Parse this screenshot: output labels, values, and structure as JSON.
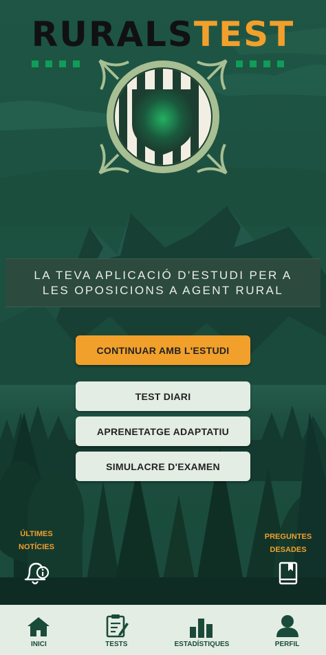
{
  "header": {
    "title_part1": "RURALS",
    "title_part2": "TEST"
  },
  "tagline": "LA TEVA APLICACIÓ D'ESTUDI PER A LES OPOSICIONS A AGENT RURAL",
  "actions": {
    "continue_label": "CONTINUAR AMB L'ESTUDI",
    "daily_test_label": "TEST DIARI",
    "adaptive_learning_label": "APRENETATGE ADAPTATIU",
    "exam_simulation_label": "SIMULACRE D'EXAMEN"
  },
  "shortcuts": {
    "news_line1": "ÚLTIMES",
    "news_line2": "NOTÍCIES",
    "news_icon": "bell-info-icon",
    "saved_line1": "PREGUNTES",
    "saved_line2": "DESADES",
    "saved_icon": "bookmark-book-icon"
  },
  "nav": {
    "items": [
      {
        "label": "INICI",
        "icon": "home-icon"
      },
      {
        "label": "TESTS",
        "icon": "clipboard-icon"
      },
      {
        "label": "ESTADÍSTIQUES",
        "icon": "bar-chart-icon"
      },
      {
        "label": "PERFIL",
        "icon": "user-icon"
      }
    ]
  },
  "colors": {
    "accent": "#f2a02c",
    "background": "#1d4f3e",
    "button_light": "#e3ede3",
    "brand_green": "#0f9d58"
  }
}
